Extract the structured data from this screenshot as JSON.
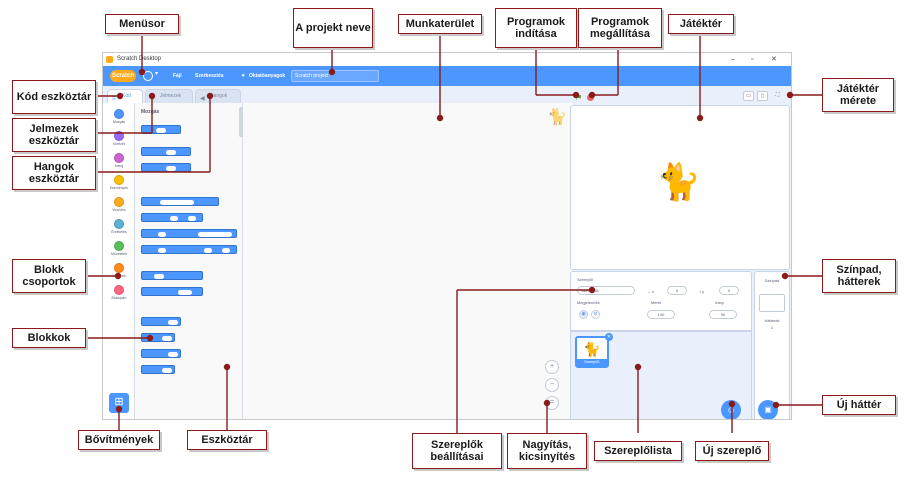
{
  "window": {
    "title": "Scratch Desktop",
    "controls": [
      "–",
      "▫",
      "✕"
    ]
  },
  "menubar": {
    "logo": "Scratch",
    "items": [
      "Fájl",
      "Szerkesztés",
      "Oktatóanyagok"
    ],
    "project_name": "Scratch projekt"
  },
  "tabs": {
    "code": "Kód",
    "costumes": "Jelmezek",
    "sounds": "Hangok"
  },
  "categories": [
    {
      "label": "Mozgás",
      "color": "#4c97ff"
    },
    {
      "label": "Kinézet",
      "color": "#9966ff"
    },
    {
      "label": "Hang",
      "color": "#cf63cf"
    },
    {
      "label": "Események",
      "color": "#ffbf00"
    },
    {
      "label": "Vezérlés",
      "color": "#ffab19"
    },
    {
      "label": "Érzékelés",
      "color": "#5cb1d6"
    },
    {
      "label": "Műveletek",
      "color": "#59c059"
    },
    {
      "label": "Változók",
      "color": "#ff8c1a"
    },
    {
      "label": "Blokkjaim",
      "color": "#ff6680"
    }
  ],
  "palette": {
    "title": "Mozgás"
  },
  "sprite_info": {
    "sprite_label": "Szereplő",
    "sprite_name": "Szereplő1",
    "x_label": "x",
    "x_value": "0",
    "y_label": "y",
    "y_value": "0",
    "show_label": "Megjelenítés",
    "size_label": "Méret",
    "size_value": "100",
    "direction_label": "Irány",
    "direction_value": "90"
  },
  "sprite_list": {
    "tile_name": "Szereplő1"
  },
  "stage_pane": {
    "title": "Színpad",
    "backdrops_label": "Hátterek",
    "backdrops_count": "1"
  },
  "annotations": {
    "menusor": "Menüsor",
    "projekt_neve": "A projekt neve",
    "munkaterulet": "Munkaterület",
    "programok_inditasa": "Programok indítása",
    "programok_megallitasa": "Programok megállítása",
    "jatekter": "Játéktér",
    "kod_eszkoztar": "Kód eszköztár",
    "jelmezek_eszkoztar": "Jelmezek eszköztár",
    "hangok_eszkoztar": "Hangok eszköztár",
    "jatekter_merete": "Játéktér mérete",
    "blokk_csoportok": "Blokk csoportok",
    "szinpad_hatterek": "Színpad, hátterek",
    "blokkok": "Blokkok",
    "uj_hatter": "Új háttér",
    "bovitmenyek": "Bővítmények",
    "eszkoztar": "Eszköztár",
    "szereplok_beallitasai": "Szereplők beállításai",
    "nagyitas": "Nagyítás, kicsinyítés",
    "szereplolista": "Szereplőlista",
    "uj_szereplo": "Új szereplő"
  },
  "colors": {
    "annotation_border": "#8b1a1a",
    "scratch_blue": "#4c97ff"
  }
}
